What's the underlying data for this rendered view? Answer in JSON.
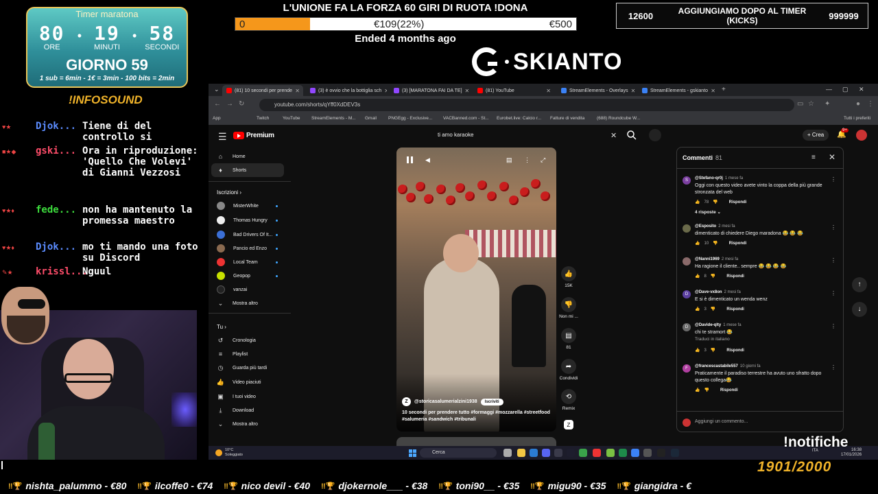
{
  "timer": {
    "title": "Timer maratona",
    "hours": "80",
    "minutes": "19",
    "seconds": "58",
    "hours_label": "ORE",
    "minutes_label": "MINUTI",
    "seconds_label": "SECONDI",
    "day": "GIORNO 59",
    "rules": "1 sub = 6min - 1€ = 3min - 100 bits = 2min"
  },
  "infosound": "!INFOSOUND",
  "donation": {
    "title": "L'UNIONE FA LA FORZA 60 GIRI DI RUOTA !DONA",
    "min": "0",
    "current": "€109(22%)",
    "max": "€500",
    "progress_fraction": 0.22,
    "status": "Ended 4 months ago",
    "fill_color": "#f5971b"
  },
  "logo": {
    "text": "SKIANTO"
  },
  "goal": {
    "left": "12600",
    "title": "AGGIUNGIAMO DOPO AL TIMER (KICKS)",
    "right": "999999"
  },
  "chat": [
    {
      "user": "Djok...",
      "message": "Tiene di del controllo si",
      "color": "#5b8cff"
    },
    {
      "user": "gski...",
      "message": "Ora in riproduzione: 'Quello Che Volevi' di Gianni Vezzosi",
      "color": "#ff4d6a"
    },
    {
      "user": "fede...",
      "message": "non ha mantenuto la promessa maestro",
      "color": "#3ddc3d"
    },
    {
      "user": "Djok...",
      "message": "mo ti mando una foto su Discord",
      "color": "#5b8cff"
    },
    {
      "user": "krissl...",
      "message": "Nguul",
      "color": "#ff4d6a"
    }
  ],
  "browser": {
    "tabs": [
      {
        "label": "(81) 10 secondi per prende",
        "color": "#ff0000"
      },
      {
        "label": "(3) è ovvio che la bottiglia sch",
        "color": "#9147ff"
      },
      {
        "label": "(3) [MARATONA FAI DA TE]",
        "color": "#9147ff"
      },
      {
        "label": "(81) YouTube",
        "color": "#ff0000"
      },
      {
        "label": "StreamElements - Overlays",
        "color": "#3b82f6"
      },
      {
        "label": "StreamElements - gskianto",
        "color": "#3b82f6"
      }
    ],
    "url": "youtube.com/shorts/qYff0XdDEV3s",
    "bookmarks": [
      "App",
      "Twitch",
      "YouTube",
      "StreamElements - M...",
      "Gmail",
      "PNGEgg - Exclusive...",
      "VACBanned.com - St...",
      "Eurobet.live: Calcio r...",
      "Fatture di vendita",
      "(688) Roundcube W..."
    ],
    "bookmarks_right": "Tutti i preferiti"
  },
  "youtube": {
    "logo_text": "Premium",
    "search_value": "ti amo karaoke",
    "create_label": "Crea",
    "bell_badge": "9+",
    "nav": [
      {
        "label": "Home"
      },
      {
        "label": "Shorts"
      }
    ],
    "subs_heading": "Iscrizioni",
    "subscriptions": [
      {
        "label": "MisterWhite",
        "color": "#888"
      },
      {
        "label": "Thomas Hungry",
        "color": "#eee"
      },
      {
        "label": "Bad Drivers Of It...",
        "color": "#3b6fd6"
      },
      {
        "label": "Pancio ed Enzo",
        "color": "#8a6a50"
      },
      {
        "label": "Local Team",
        "color": "#e33"
      },
      {
        "label": "Geopop",
        "color": "#c7e000"
      },
      {
        "label": "vanzai",
        "color": "#222"
      },
      {
        "label": "Mostra altro",
        "color": ""
      }
    ],
    "you_heading": "Tu",
    "you_items": [
      "Cronologia",
      "Playlist",
      "Guarda più tardi",
      "Video piaciuti",
      "I tuoi video",
      "Download",
      "Mostra altro"
    ],
    "short": {
      "channel": "@storicasalumerialzini1938",
      "subscribe": "Iscriviti",
      "caption": "10 secondi per prendere tutto #formaggi #mozzarella #streetfood #salumeria #sandwich #tribunali"
    },
    "actions": [
      {
        "label": "15K",
        "icon": "like-icon"
      },
      {
        "label": "Non mi ...",
        "icon": "dislike-icon"
      },
      {
        "label": "81",
        "icon": "comment-icon"
      },
      {
        "label": "Condividi",
        "icon": "share-icon"
      },
      {
        "label": "Remix",
        "icon": "remix-icon"
      }
    ],
    "comments": {
      "title": "Commenti",
      "count": "81",
      "items": [
        {
          "user": "@Stefano-qr0j",
          "time": "1 mese fa",
          "text": "Oggi con questo video avete vinto la coppa della più grande stronzata del web",
          "likes": "78",
          "avatar": "S",
          "color": "#7b3fa0"
        },
        {
          "user": "@Esposito",
          "time": "2 mesi fa",
          "text": "dimenticato di chiedere Diego maradona 😂 😂 😂",
          "likes": "10",
          "avatar": "",
          "color": "#6a6a4a"
        },
        {
          "user": "@Nanni1969",
          "time": "2 mesi fa",
          "text": "Ha ragione il cliente.. sempre 😂 😂 😂 😂",
          "likes": "8",
          "avatar": "",
          "color": "#8a6a6a"
        },
        {
          "user": "@Dave-vx8on",
          "time": "2 mesi fa",
          "text": "E si è dimenticato un wenda wenz",
          "likes": "3",
          "avatar": "D",
          "color": "#5b3fa0"
        },
        {
          "user": "@Davide-qlty",
          "time": "1 mese fa",
          "text": "chi te stramort 😂",
          "likes": "3",
          "avatar": "D",
          "color": "#6a6a6a"
        },
        {
          "user": "@francescastabile557",
          "time": "10 giorni fa",
          "text": "Praticamente il paradiso terrestre ha avuto uno sfratto dopo questo collega😂",
          "likes": "",
          "avatar": "F",
          "color": "#b03fa0"
        }
      ],
      "replies_label": "4 risposte",
      "reply_label": "Rispondi",
      "translate_label": "Traduci in italiano",
      "input_placeholder": "Aggiungi un commento..."
    }
  },
  "taskbar": {
    "weather_temp": "10°C",
    "weather_desc": "Soleggiato",
    "search": "Cerca",
    "lang": "ITA",
    "time": "16:38",
    "date": "17/01/2026"
  },
  "notifiche": "!notifiche",
  "counter": "1901/2000",
  "ticker": [
    "nishta_palummo - €80",
    "ilcoffe0 - €74",
    "nico devil - €40",
    "djokernole___ - €38",
    "toni90__ - €35",
    "migu90 - €35",
    "giangidra - €"
  ]
}
